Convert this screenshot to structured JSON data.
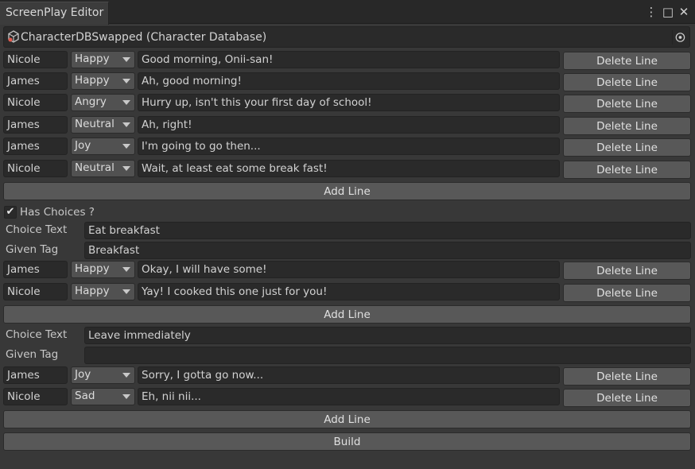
{
  "window": {
    "tab_title": "ScreenPlay Editor",
    "menu_icon": "⋮",
    "maximize_icon": "□",
    "close_icon": "✕"
  },
  "database_field": {
    "value": "CharacterDBSwapped (Character Database)"
  },
  "main_lines": [
    {
      "character": "Nicole",
      "emotion": "Happy",
      "text": "Good morning, Onii-san!",
      "delete_label": "Delete Line"
    },
    {
      "character": "James",
      "emotion": "Happy",
      "text": "Ah, good morning!",
      "delete_label": "Delete Line"
    },
    {
      "character": "Nicole",
      "emotion": "Angry",
      "text": "Hurry up, isn't this your first day of school!",
      "delete_label": "Delete Line"
    },
    {
      "character": "James",
      "emotion": "Neutral",
      "text": "Ah, right!",
      "delete_label": "Delete Line"
    },
    {
      "character": "James",
      "emotion": "Joy",
      "text": "I'm going to go then...",
      "delete_label": "Delete Line"
    },
    {
      "character": "Nicole",
      "emotion": "Neutral",
      "text": "Wait, at least eat some break fast!",
      "delete_label": "Delete Line"
    }
  ],
  "add_line_label": "Add Line",
  "has_choices": {
    "label": "Has Choices ?",
    "checked": true,
    "check_glyph": "✔"
  },
  "choices": [
    {
      "choice_text_label": "Choice Text",
      "choice_text": "Eat breakfast",
      "given_tag_label": "Given Tag",
      "given_tag": "Breakfast",
      "lines": [
        {
          "character": "James",
          "emotion": "Happy",
          "text": "Okay, I will have some!",
          "delete_label": "Delete Line"
        },
        {
          "character": "Nicole",
          "emotion": "Happy",
          "text": "Yay! I cooked this one just for you!",
          "delete_label": "Delete Line"
        }
      ]
    },
    {
      "choice_text_label": "Choice Text",
      "choice_text": "Leave immediately",
      "given_tag_label": "Given Tag",
      "given_tag": "",
      "lines": [
        {
          "character": "James",
          "emotion": "Joy",
          "text": "Sorry, I gotta go now...",
          "delete_label": "Delete Line"
        },
        {
          "character": "Nicole",
          "emotion": "Sad",
          "text": "Eh, nii nii...",
          "delete_label": "Delete Line"
        }
      ]
    }
  ],
  "build_label": "Build"
}
